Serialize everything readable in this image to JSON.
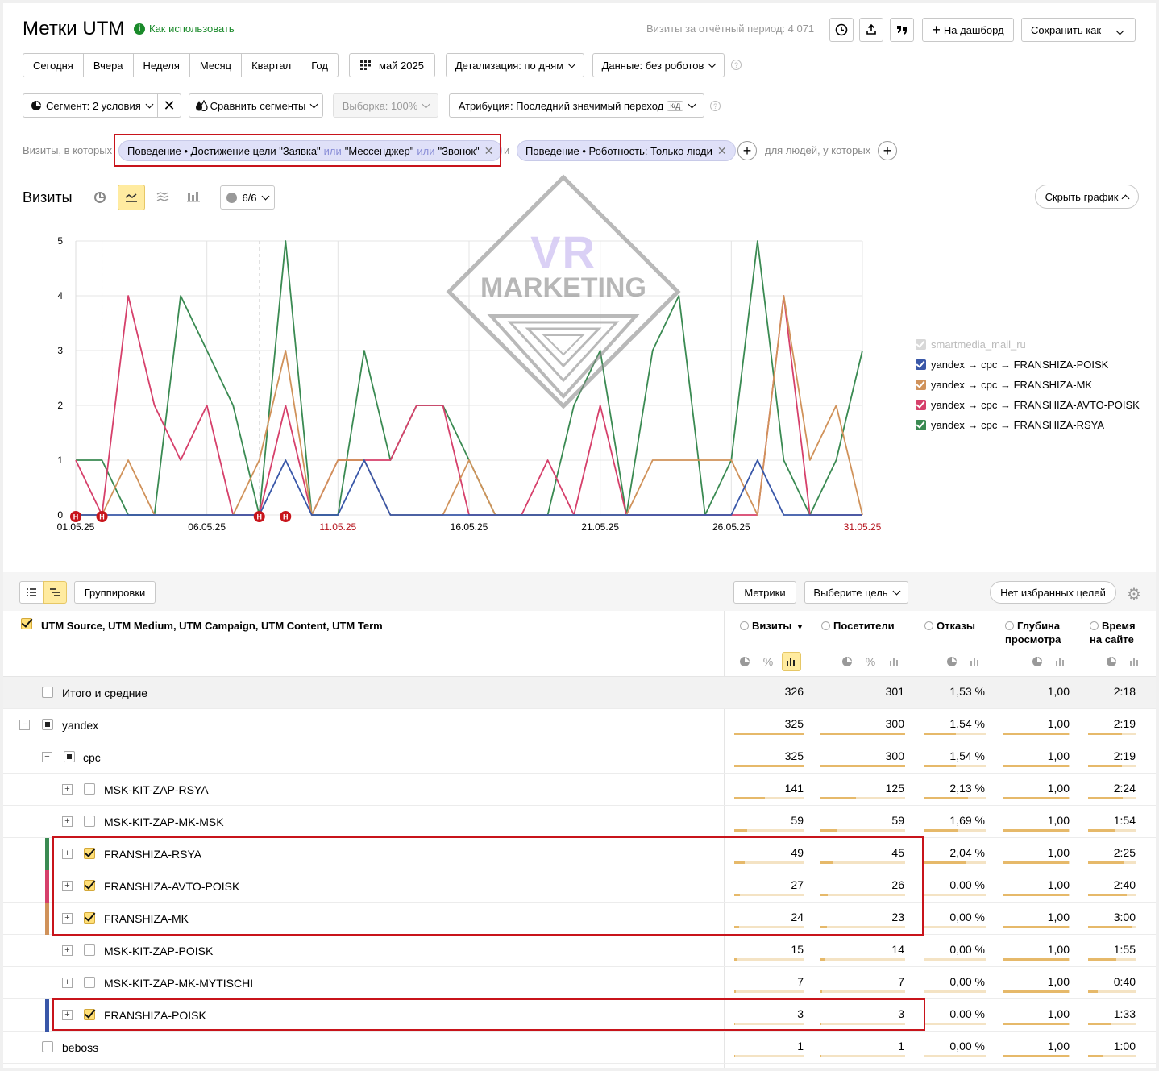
{
  "header": {
    "title": "Метки UTM",
    "how_to_use": "Как использовать",
    "visits_period": "Визиты за отчётный период: 4 071",
    "to_dashboard": "На дашборд",
    "save_as": "Сохранить как"
  },
  "periods": [
    "Сегодня",
    "Вчера",
    "Неделя",
    "Месяц",
    "Квартал",
    "Год"
  ],
  "date_picker": "май 2025",
  "detail": "Детализация: по дням",
  "data_filter": "Данные: без роботов",
  "segment": "Сегмент: 2 условия",
  "compare": "Сравнить сегменты",
  "sample": "Выборка: 100%",
  "attribution": "Атрибуция: Последний значимый переход",
  "attribution_badge": "к/д",
  "filters": {
    "visits_where": "Визиты, в которых",
    "cond1_prefix": "Поведение • Достижение цели \"Заявка\"",
    "or": "или",
    "cond1_b": "\"Мессенджер\"",
    "cond1_c": "\"Звонок\"",
    "and": "и",
    "cond2": "Поведение • Роботность: Только люди",
    "people_where": "для людей, у которых"
  },
  "chart_section": {
    "title": "Визиты",
    "series_count": "6/6",
    "hide_chart": "Скрыть график"
  },
  "chart_data": {
    "type": "line",
    "x": [
      "01.05.25",
      "02.05.25",
      "03.05.25",
      "04.05.25",
      "05.05.25",
      "06.05.25",
      "07.05.25",
      "08.05.25",
      "09.05.25",
      "10.05.25",
      "11.05.25",
      "12.05.25",
      "13.05.25",
      "14.05.25",
      "15.05.25",
      "16.05.25",
      "17.05.25",
      "18.05.25",
      "19.05.25",
      "20.05.25",
      "21.05.25",
      "22.05.25",
      "23.05.25",
      "24.05.25",
      "25.05.25",
      "26.05.25",
      "27.05.25",
      "28.05.25",
      "29.05.25",
      "30.05.25",
      "31.05.25"
    ],
    "x_tick_labels": [
      "01.05.25",
      "06.05.25",
      "11.05.25",
      "16.05.25",
      "21.05.25",
      "26.05.25",
      "31.05.25"
    ],
    "holiday_ticks": [
      "11.05.25",
      "31.05.25"
    ],
    "y_ticks": [
      0,
      1,
      2,
      3,
      4,
      5
    ],
    "ylim": [
      0,
      5
    ],
    "series": [
      {
        "name": "yandex → cpc → FRANSHIZA-POISK",
        "color": "#3957a8",
        "values": [
          0,
          0,
          0,
          0,
          0,
          0,
          0,
          0,
          1,
          0,
          0,
          1,
          0,
          0,
          0,
          0,
          0,
          0,
          0,
          0,
          0,
          0,
          0,
          0,
          0,
          0,
          1,
          0,
          0,
          0,
          0
        ]
      },
      {
        "name": "yandex → cpc → FRANSHIZA-MK",
        "color": "#d0925a",
        "values": [
          0,
          0,
          1,
          0,
          0,
          0,
          0,
          1,
          3,
          0,
          1,
          1,
          0,
          0,
          0,
          1,
          0,
          0,
          0,
          0,
          0,
          0,
          1,
          1,
          1,
          1,
          0,
          4,
          1,
          2,
          0
        ]
      },
      {
        "name": "yandex → cpc → FRANSHIZA-AVTO-POISK",
        "color": "#d6406b",
        "values": [
          1,
          0,
          4,
          2,
          1,
          2,
          0,
          0,
          2,
          0,
          1,
          1,
          1,
          2,
          2,
          0,
          0,
          0,
          1,
          0,
          2,
          0,
          0,
          0,
          0,
          0,
          0,
          4,
          0,
          0,
          0
        ]
      },
      {
        "name": "yandex → cpc → FRANSHIZA-RSYA",
        "color": "#3a8a52",
        "values": [
          1,
          1,
          0,
          0,
          4,
          3,
          2,
          0,
          5,
          0,
          0,
          3,
          1,
          2,
          2,
          1,
          0,
          0,
          0,
          2,
          3,
          0,
          3,
          4,
          0,
          1,
          5,
          1,
          0,
          1,
          3
        ]
      }
    ],
    "legend_disabled": "smartmedia_mail_ru",
    "markers": [
      "H",
      "H",
      "H",
      "H"
    ]
  },
  "table": {
    "view_groups": "Группировки",
    "metrics": "Метрики",
    "choose_goal": "Выберите цель",
    "no_fav": "Нет избранных целей",
    "dim_header": "UTM Source, UTM Medium, UTM Campaign, UTM Content, UTM Term",
    "cols": [
      "Визиты",
      "Посетители",
      "Отказы",
      "Глубина просмотра",
      "Время на сайте"
    ],
    "total": {
      "name": "Итого и средние",
      "v": "326",
      "p": "301",
      "b": "1,53 %",
      "d": "1,00",
      "t": "2:18"
    },
    "rows": [
      {
        "name": "yandex",
        "v": "325",
        "p": "300",
        "b": "1,54 %",
        "d": "1,00",
        "t": "2:19"
      },
      {
        "name": "cpc",
        "v": "325",
        "p": "300",
        "b": "1,54 %",
        "d": "1,00",
        "t": "2:19"
      },
      {
        "name": "MSK-KIT-ZAP-RSYA",
        "v": "141",
        "p": "125",
        "b": "2,13 %",
        "d": "1,00",
        "t": "2:24"
      },
      {
        "name": "MSK-KIT-ZAP-MK-MSK",
        "v": "59",
        "p": "59",
        "b": "1,69 %",
        "d": "1,00",
        "t": "1:54"
      },
      {
        "name": "FRANSHIZA-RSYA",
        "v": "49",
        "p": "45",
        "b": "2,04 %",
        "d": "1,00",
        "t": "2:25"
      },
      {
        "name": "FRANSHIZA-AVTO-POISK",
        "v": "27",
        "p": "26",
        "b": "0,00 %",
        "d": "1,00",
        "t": "2:40"
      },
      {
        "name": "FRANSHIZA-MK",
        "v": "24",
        "p": "23",
        "b": "0,00 %",
        "d": "1,00",
        "t": "3:00"
      },
      {
        "name": "MSK-KIT-ZAP-POISK",
        "v": "15",
        "p": "14",
        "b": "0,00 %",
        "d": "1,00",
        "t": "1:55"
      },
      {
        "name": "MSK-KIT-ZAP-MK-MYTISCHI",
        "v": "7",
        "p": "7",
        "b": "0,00 %",
        "d": "1,00",
        "t": "0:40"
      },
      {
        "name": "FRANSHIZA-POISK",
        "v": "3",
        "p": "3",
        "b": "0,00 %",
        "d": "1,00",
        "t": "1:33"
      },
      {
        "name": "beboss",
        "v": "1",
        "p": "1",
        "b": "0,00 %",
        "d": "1,00",
        "t": "1:00"
      }
    ]
  },
  "watermark": {
    "line1": "VR",
    "line2": "MARKETING"
  }
}
